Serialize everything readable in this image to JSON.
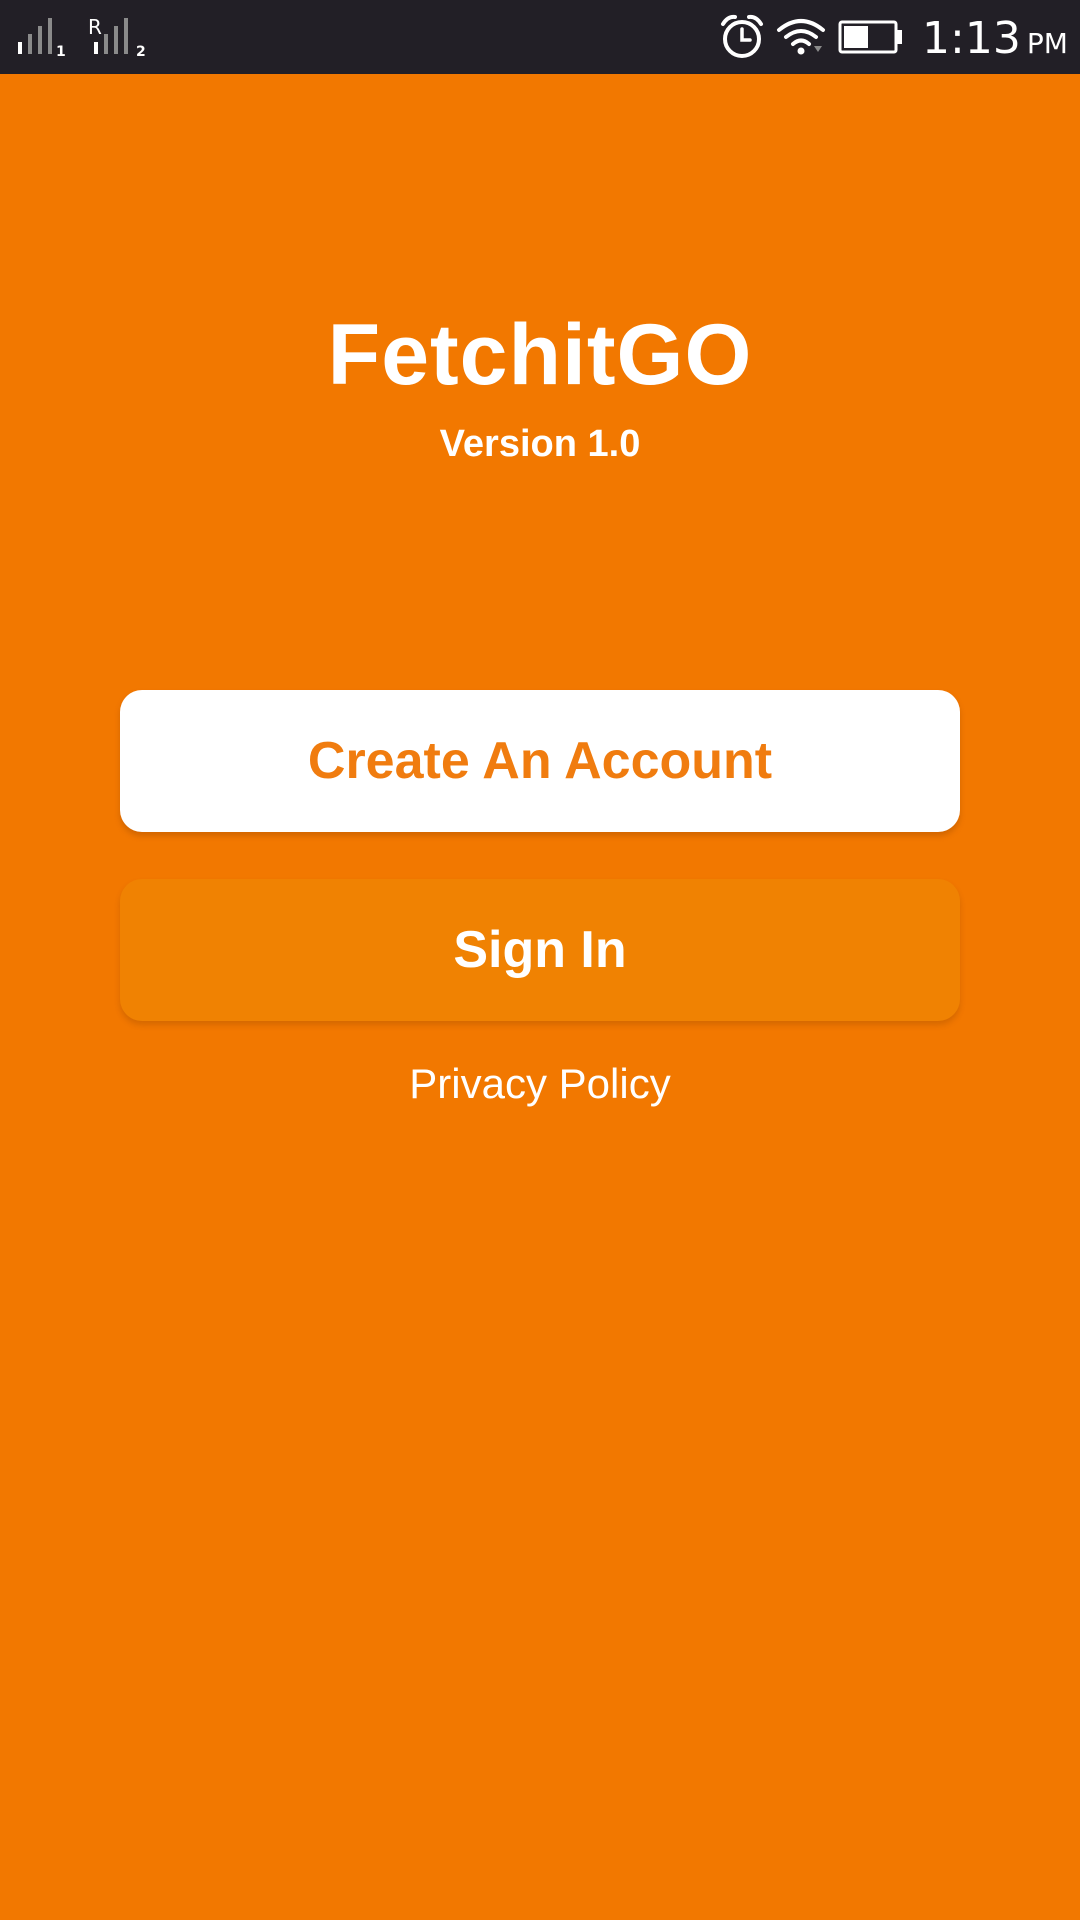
{
  "status_bar": {
    "sim1_label": "1",
    "sim2_roaming_label": "R",
    "sim2_label": "2",
    "time": "1:13",
    "ampm": "PM",
    "icons": [
      "signal-sim1-icon",
      "signal-sim2-roaming-icon",
      "alarm-icon",
      "wifi-icon",
      "battery-icon"
    ],
    "battery_level": 0.5
  },
  "app": {
    "title": "FetchitGO",
    "version": "Version 1.0"
  },
  "actions": {
    "create_account_label": "Create An Account",
    "sign_in_label": "Sign In",
    "privacy_policy_label": "Privacy Policy"
  },
  "colors": {
    "background": "#f27800",
    "status_bar": "#221f26",
    "primary_text_on_white": "#f07c0f",
    "sign_in_button": "#f08202"
  }
}
